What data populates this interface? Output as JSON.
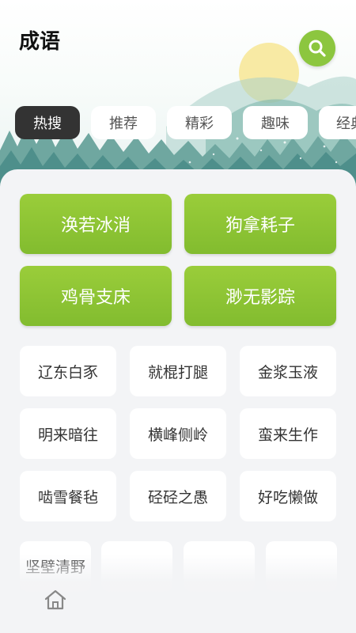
{
  "header": {
    "title": "成语"
  },
  "colors": {
    "accent": "#8cc63f",
    "active_tab": "#333333"
  },
  "icons": {
    "search": "search-icon",
    "home": "home-icon"
  },
  "tabs": [
    {
      "label": "热搜",
      "active": true
    },
    {
      "label": "推荐",
      "active": false
    },
    {
      "label": "精彩",
      "active": false
    },
    {
      "label": "趣味",
      "active": false
    },
    {
      "label": "经典",
      "active": false
    }
  ],
  "featured": [
    "涣若冰消",
    "狗拿耗子",
    "鸡骨支床",
    "渺无影踪"
  ],
  "idioms": [
    "辽东白豕",
    "就棍打腿",
    "金浆玉液",
    "明来暗往",
    "横峰侧岭",
    "蛮来生作",
    "啮雪餐毡",
    "硁硁之愚",
    "好吃懒做"
  ],
  "partial_row": [
    "坚壁清野",
    "",
    "",
    ""
  ]
}
